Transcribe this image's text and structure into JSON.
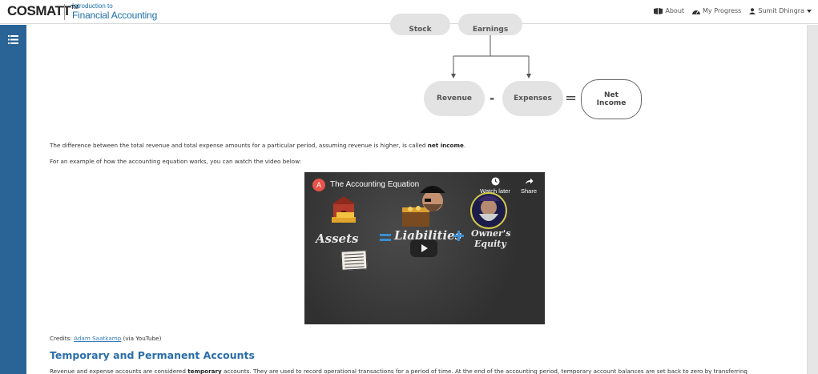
{
  "header": {
    "brand": "COSMATT",
    "brand_tm": "TM",
    "course_subtitle": "Introduction to",
    "course_title": "Financial Accounting",
    "nav": {
      "about": "About",
      "progress": "My Progress",
      "user": "Sumit Dhingra"
    }
  },
  "sidebar": {
    "menu_icon": "list-icon"
  },
  "diagram": {
    "top_left": "Stock",
    "top_right": "Earnings",
    "revenue": "Revenue",
    "minus": "-",
    "expenses": "Expenses",
    "equals": "=",
    "net_income_line1": "Net",
    "net_income_line2": "Income"
  },
  "content": {
    "para1_before": "The difference between the total revenue and total expense amounts for a particular period, assuming revenue is higher, is called ",
    "para1_bold": "net income",
    "para1_after": ".",
    "para2": "For an example of how the accounting equation works, you can watch the video below:",
    "credits_prefix": "Credits: ",
    "credits_link": "Adam Saatkamp",
    "credits_suffix": " (via YouTube)",
    "section_heading": "Temporary and Permanent Accounts",
    "para3_before": "Revenue and expense accounts are considered ",
    "para3_bold": "temporary",
    "para3_after": " accounts. They are used to record operational transactions for a period of time. At the end of the accounting period, temporary account balances are set back to zero by transferring"
  },
  "video": {
    "channel_initial": "A",
    "title": "The Accounting Equation",
    "watch_later": "Watch later",
    "share": "Share",
    "word_assets": "Assets",
    "word_liabilities": "Liabilities",
    "word_owners": "Owner's",
    "word_equity": "Equity"
  },
  "colors": {
    "sidebar": "#2a6496",
    "link": "#337ab7",
    "heading": "#2a6ea8",
    "brand_blue": "#1a6fa8"
  }
}
